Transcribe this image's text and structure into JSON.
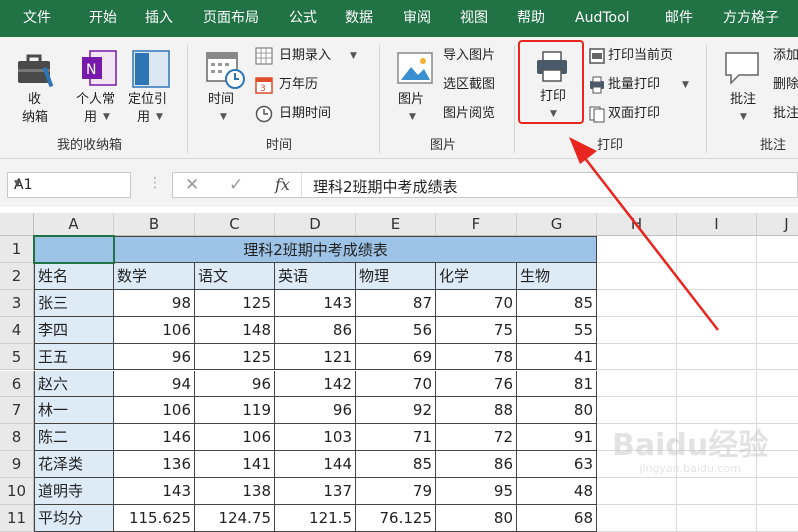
{
  "menu": {
    "tabs": [
      "文件",
      "开始",
      "插入",
      "页面布局",
      "公式",
      "数据",
      "审阅",
      "视图",
      "帮助",
      "AudTool",
      "邮件",
      "方方格子"
    ]
  },
  "ribbon": {
    "my_box": {
      "btn_box": "收",
      "btn_box2": "纳箱",
      "btn_personal": "个人常",
      "btn_personal2": "用",
      "btn_locate": "定位引",
      "btn_locate2": "用",
      "group_label": "我的收纳箱"
    },
    "time": {
      "btn_time": "时间",
      "date_entry": "日期录入",
      "calendar": "万年历",
      "datetime": "日期时间",
      "group_label": "时间"
    },
    "picture": {
      "btn_picture": "图片",
      "import": "导入图片",
      "area_capture": "选区截图",
      "viewer": "图片阅览",
      "group_label": "图片"
    },
    "print": {
      "btn_print": "打印",
      "print_current": "打印当前页",
      "batch_print": "批量打印",
      "duplex_print": "双面打印",
      "group_label": "打印"
    },
    "comment": {
      "btn_comment": "批注",
      "add": "添加",
      "delete": "删除",
      "batch": "批注",
      "group_label": "批注"
    }
  },
  "formula_bar": {
    "name_box": "A1",
    "fx_label": "fx",
    "formula": "理科2班期中考成绩表"
  },
  "sheet": {
    "columns": [
      "A",
      "B",
      "C",
      "D",
      "E",
      "F",
      "G",
      "H",
      "I",
      "J"
    ],
    "rows": [
      "1",
      "2",
      "3",
      "4",
      "5",
      "6",
      "7",
      "8",
      "9",
      "10",
      "11"
    ],
    "title": "理科2班期中考成绩表",
    "headers": [
      "姓名",
      "数学",
      "语文",
      "英语",
      "物理",
      "化学",
      "生物"
    ],
    "data": [
      [
        "张三",
        "98",
        "125",
        "143",
        "87",
        "70",
        "85"
      ],
      [
        "李四",
        "106",
        "148",
        "86",
        "56",
        "75",
        "55"
      ],
      [
        "王五",
        "96",
        "125",
        "121",
        "69",
        "78",
        "41"
      ],
      [
        "赵六",
        "94",
        "96",
        "142",
        "70",
        "76",
        "81"
      ],
      [
        "林一",
        "106",
        "119",
        "96",
        "92",
        "88",
        "80"
      ],
      [
        "陈二",
        "146",
        "106",
        "103",
        "71",
        "72",
        "91"
      ],
      [
        "花泽类",
        "136",
        "141",
        "144",
        "85",
        "86",
        "63"
      ],
      [
        "道明寺",
        "143",
        "138",
        "137",
        "79",
        "95",
        "48"
      ],
      [
        "平均分",
        "115.625",
        "124.75",
        "121.5",
        "76.125",
        "80",
        "68"
      ]
    ]
  },
  "watermark": {
    "brand": "Baidu经验",
    "url": "jingyan.baidu.com"
  },
  "colors": {
    "excel_green": "#217346",
    "title_fill": "#9dc3e6",
    "header_fill": "#ddebf7",
    "highlight": "#e8261f"
  }
}
